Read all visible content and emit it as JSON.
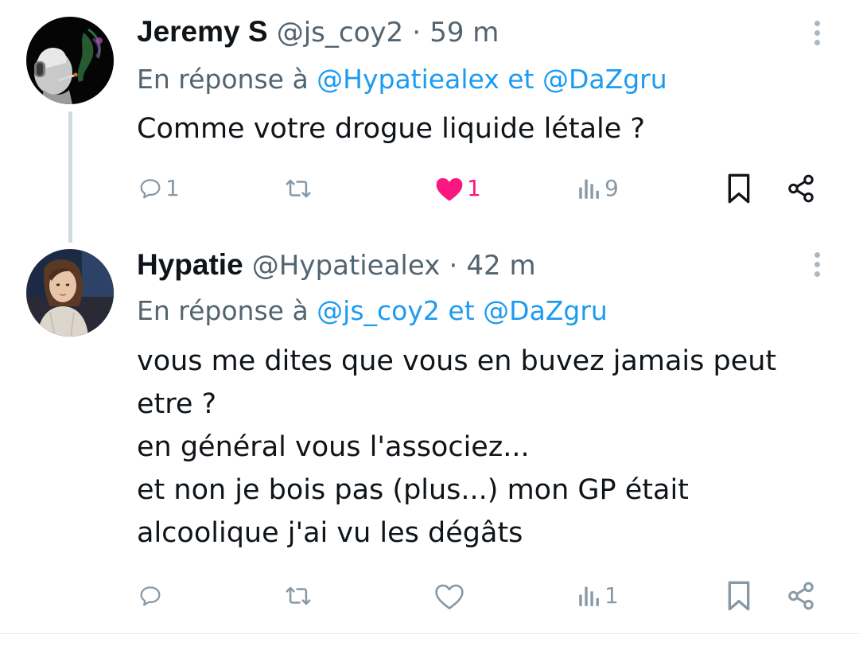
{
  "colors": {
    "accent": "#1d9bf0",
    "like": "#f91880",
    "muted": "#536471",
    "icon_gray": "#8899a6",
    "thread_line": "#cfd9de"
  },
  "tweets": [
    {
      "display_name": "Jeremy S",
      "handle": "@js_coy2",
      "separator": "·",
      "time": "59 m",
      "reply_prefix": "En réponse à",
      "reply_mention_1": "@Hypatiealex",
      "reply_joiner": "et",
      "reply_mention_2": "@DaZgru",
      "text_lines": [
        "Comme votre drogue liquide létale ?"
      ],
      "counts": {
        "replies": "1",
        "retweets": "",
        "likes": "1",
        "views": "9"
      },
      "liked": true,
      "icons": {
        "more": "more-vertical-icon",
        "reply": "reply-icon",
        "retweet": "retweet-icon",
        "like": "heart-filled-icon",
        "views": "views-icon",
        "bookmark": "bookmark-icon",
        "share": "share-icon"
      }
    },
    {
      "display_name": "Hypatie",
      "handle": "@Hypatiealex",
      "separator": "·",
      "time": "42 m",
      "reply_prefix": "En réponse à",
      "reply_mention_1": "@js_coy2",
      "reply_joiner": "et",
      "reply_mention_2": "@DaZgru",
      "text_lines": [
        "vous me dites que vous en buvez jamais peut",
        "etre ?",
        "en général vous l'associez...",
        "et non je bois pas (plus...) mon GP était",
        "alcoolique j'ai vu les dégâts"
      ],
      "counts": {
        "replies": "",
        "retweets": "",
        "likes": "",
        "views": "1"
      },
      "liked": false,
      "icons": {
        "more": "more-vertical-icon",
        "reply": "reply-icon",
        "retweet": "retweet-icon",
        "like": "heart-outline-icon",
        "views": "views-icon",
        "bookmark": "bookmark-icon",
        "share": "share-icon"
      }
    }
  ]
}
